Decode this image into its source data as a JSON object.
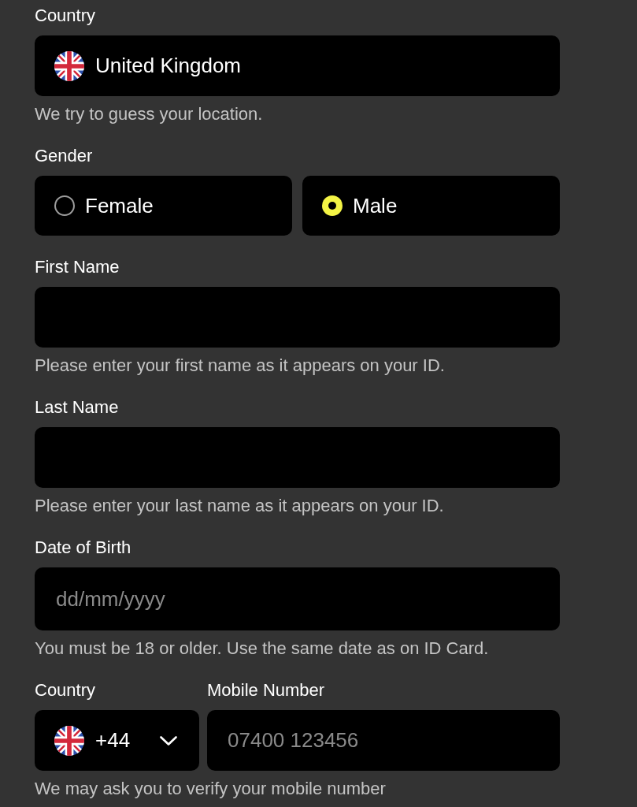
{
  "fields": [
    {
      "kind": "select",
      "label": "Country",
      "value": "United Kingdom",
      "hint": "We try to guess your location."
    },
    {
      "kind": "radio",
      "label": "Gender",
      "options": [
        {
          "label": "Female",
          "selected": false
        },
        {
          "label": "Male",
          "selected": true
        }
      ]
    },
    {
      "kind": "text",
      "label": "First Name",
      "hint": "Please enter your first name as it appears on your ID."
    },
    {
      "kind": "text",
      "label": "Last Name",
      "hint": "Please enter your last name as it appears on your ID."
    },
    {
      "kind": "date",
      "label": "Date of Birth",
      "placeholder": "dd/mm/yyyy",
      "hint": "You must be 18 or older. Use the same date as on ID Card."
    },
    {
      "kind": "phone",
      "country": {
        "label": "Country",
        "value": "+44"
      },
      "number": {
        "label": "Mobile Number",
        "placeholder": "07400 123456"
      },
      "hint": "We may ask you to verify your mobile number"
    }
  ]
}
